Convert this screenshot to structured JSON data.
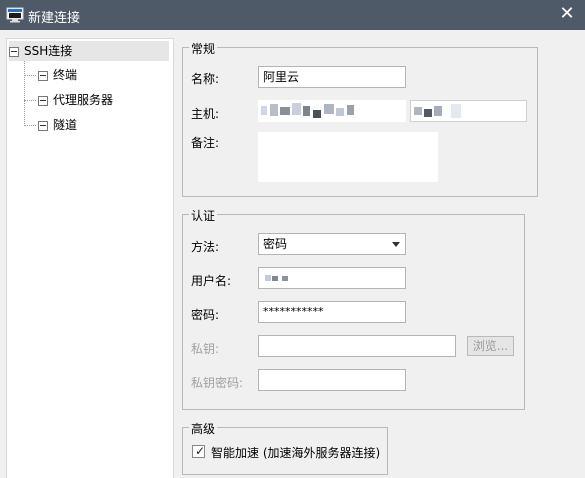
{
  "window": {
    "title": "新建连接",
    "close_glyph": "✕"
  },
  "tree": {
    "root_label": "SSH连接",
    "children": [
      {
        "label": "终端"
      },
      {
        "label": "代理服务器"
      },
      {
        "label": "隧道"
      }
    ]
  },
  "general": {
    "title": "常规",
    "name_label": "名称:",
    "name_value": "阿里云",
    "host_label": "主机:",
    "note_label": "备注:"
  },
  "auth": {
    "title": "认证",
    "method_label": "方法:",
    "method_value": "密码",
    "username_label": "用户名:",
    "password_label": "密码:",
    "password_value": "***********",
    "private_key_label": "私钥:",
    "browse_label": "浏览...",
    "key_password_label": "私钥密码:"
  },
  "advanced": {
    "title": "高级",
    "smart_accel_label": "智能加速 (加速海外服务器连接)",
    "smart_accel_checked": true
  },
  "icons": {
    "app": "terminal-window-icon",
    "close": "close-icon",
    "check": "check-icon"
  },
  "colors": {
    "titlebar": "#4e5a68",
    "background": "#f0f0f0",
    "tree_selected": "#e6e6e6"
  }
}
